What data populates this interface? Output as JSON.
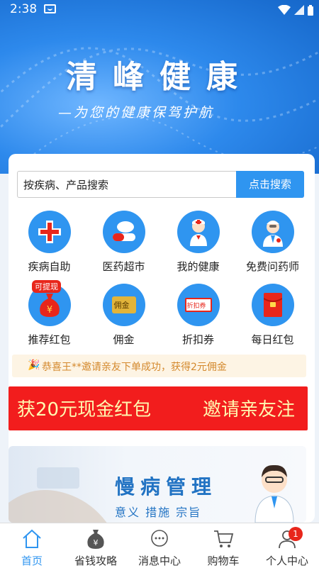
{
  "status_bar": {
    "time": "2:38"
  },
  "banner": {
    "title": "清峰健康",
    "slogan": "—为您的健康保驾护航"
  },
  "search": {
    "placeholder": "按疾病、产品搜索",
    "button": "点击搜索"
  },
  "grid": [
    {
      "label": "疾病自助",
      "icon": "medical-cross-icon"
    },
    {
      "label": "医药超市",
      "icon": "pill-icon"
    },
    {
      "label": "我的健康",
      "icon": "nurse-icon"
    },
    {
      "label": "免费问药师",
      "icon": "doctor-icon"
    },
    {
      "label": "推荐红包",
      "icon": "money-bag-icon",
      "tag": "可提现"
    },
    {
      "label": "佣金",
      "icon": "commission-card-icon",
      "card_text": "佣金"
    },
    {
      "label": "折扣券",
      "icon": "coupon-icon",
      "card_text": "折扣券"
    },
    {
      "label": "每日红包",
      "icon": "red-envelope-icon"
    }
  ],
  "notice": {
    "text": "恭喜王**邀请亲友下单成功，获得2元佣金"
  },
  "promo": {
    "left": "获20元现金红包",
    "right": "邀请亲友注"
  },
  "chronic": {
    "title": "慢病管理",
    "subtitle": "意义  措施  宗旨"
  },
  "tabbar": [
    {
      "label": "首页",
      "icon": "home-icon",
      "active": true
    },
    {
      "label": "省钱攻略",
      "icon": "money-bag-icon"
    },
    {
      "label": "消息中心",
      "icon": "chat-icon"
    },
    {
      "label": "购物车",
      "icon": "cart-icon"
    },
    {
      "label": "个人中心",
      "icon": "user-icon",
      "badge": "1"
    }
  ],
  "colors": {
    "primary": "#2f95f0",
    "red": "#f21d1d",
    "notice_text": "#d4892d"
  }
}
